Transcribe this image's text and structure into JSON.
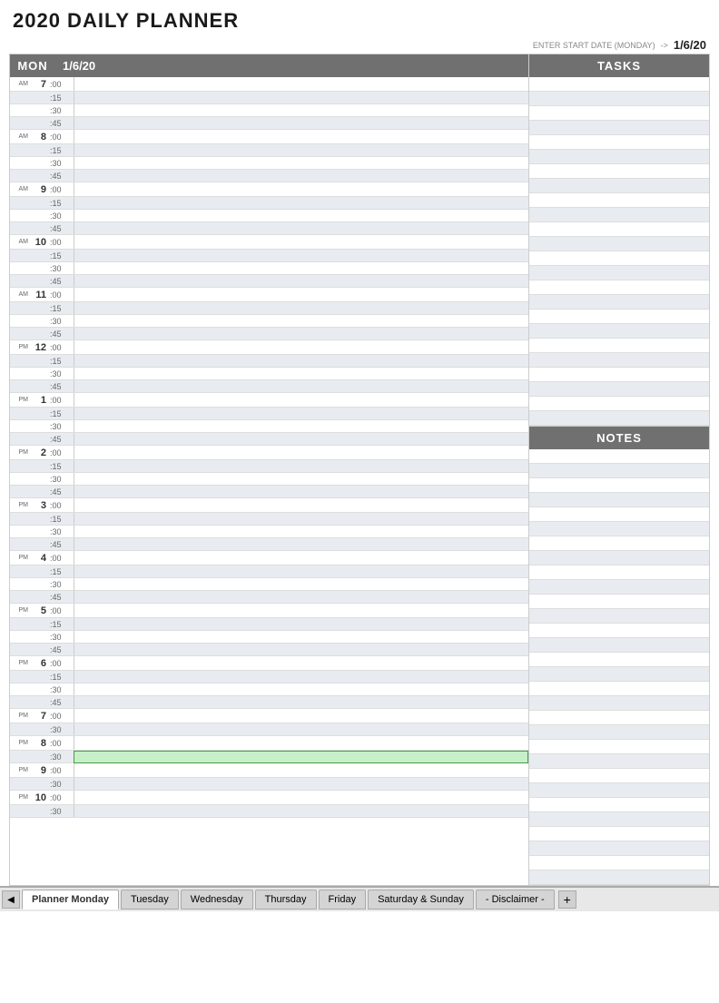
{
  "title": "2020 DAILY PLANNER",
  "start_date_label": "ENTER START DATE (MONDAY)",
  "start_date_arrow": "->",
  "start_date_value": "1/6/20",
  "schedule": {
    "day_label": "MON",
    "date_label": "1/6/20",
    "hours": [
      {
        "hour": "7",
        "ampm": "AM",
        "slots": [
          ":00",
          ":15",
          ":30",
          ":45"
        ]
      },
      {
        "hour": "8",
        "ampm": "AM",
        "slots": [
          ":00",
          ":15",
          ":30",
          ":45"
        ]
      },
      {
        "hour": "9",
        "ampm": "AM",
        "slots": [
          ":00",
          ":15",
          ":30",
          ":45"
        ]
      },
      {
        "hour": "10",
        "ampm": "AM",
        "slots": [
          ":00",
          ":15",
          ":30",
          ":45"
        ]
      },
      {
        "hour": "11",
        "ampm": "AM",
        "slots": [
          ":00",
          ":15",
          ":30",
          ":45"
        ]
      },
      {
        "hour": "12",
        "ampm": "PM",
        "slots": [
          ":00",
          ":15",
          ":30",
          ":45"
        ]
      },
      {
        "hour": "1",
        "ampm": "PM",
        "slots": [
          ":00",
          ":15",
          ":30",
          ":45"
        ]
      },
      {
        "hour": "2",
        "ampm": "PM",
        "slots": [
          ":00",
          ":15",
          ":30",
          ":45"
        ]
      },
      {
        "hour": "3",
        "ampm": "PM",
        "slots": [
          ":00",
          ":15",
          ":30",
          ":45"
        ]
      },
      {
        "hour": "4",
        "ampm": "PM",
        "slots": [
          ":00",
          ":15",
          ":30",
          ":45"
        ]
      },
      {
        "hour": "5",
        "ampm": "PM",
        "slots": [
          ":00",
          ":15",
          ":30",
          ":45"
        ]
      },
      {
        "hour": "6",
        "ampm": "PM",
        "slots": [
          ":00",
          ":15",
          ":30",
          ":45"
        ]
      },
      {
        "hour": "7",
        "ampm": "PM",
        "slots": [
          ":00",
          ":30"
        ]
      },
      {
        "hour": "8",
        "ampm": "PM",
        "slots": [
          ":00",
          ":30"
        ]
      },
      {
        "hour": "9",
        "ampm": "PM",
        "slots": [
          ":00",
          ":30"
        ]
      },
      {
        "hour": "10",
        "ampm": "PM",
        "slots": [
          ":00",
          ":30"
        ]
      }
    ]
  },
  "sidebar": {
    "tasks_label": "TASKS",
    "notes_label": "NOTES",
    "tasks_row_count": 24,
    "notes_row_count": 30
  },
  "tabs": [
    {
      "label": "Planner Monday",
      "active": true
    },
    {
      "label": "Tuesday",
      "active": false
    },
    {
      "label": "Wednesday",
      "active": false
    },
    {
      "label": "Thursday",
      "active": false
    },
    {
      "label": "Friday",
      "active": false
    },
    {
      "label": "Saturday & Sunday",
      "active": false
    },
    {
      "label": "- Disclaimer -",
      "active": false
    }
  ],
  "tab_nav_prev": "◀",
  "tab_nav_next": "▶",
  "tab_add": "+"
}
